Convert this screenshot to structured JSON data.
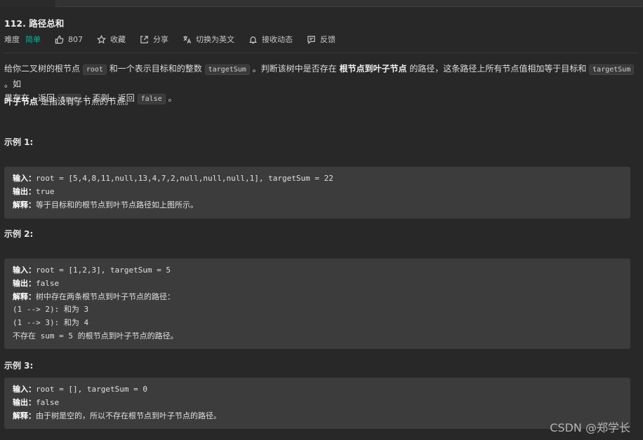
{
  "problem": {
    "title": "112. 路径总和",
    "difficulty_label": "难度",
    "difficulty": "简单",
    "likes": "807",
    "favorite": "收藏",
    "share": "分享",
    "switch_lang": "切换为英文",
    "notify": "接收动态",
    "feedback": "反馈"
  },
  "description": {
    "p1_a": "给你二叉树的根节点",
    "p1_code1": "root",
    "p1_b": "和一个表示目标和的整数",
    "p1_code2": "targetSum",
    "p1_c": "。判断该树中是否存在",
    "p1_bold": "根节点到叶子节点",
    "p1_d": "的路径，这条路径上所有节点值相加等于目标和",
    "p1_code3": "targetSum",
    "p1_e": "。如",
    "p1_f": "果存在，返回",
    "p1_code4": "true",
    "p1_g": "；否则，返回",
    "p1_code5": "false",
    "p1_h": "。",
    "p2_bold": "叶子节点",
    "p2_rest": "是指没有子节点的节点。"
  },
  "examples": [
    {
      "title": "示例 1:",
      "input_label": "输入：",
      "input": "root = [5,4,8,11,null,13,4,7,2,null,null,null,1], targetSum = 22",
      "output_label": "输出：",
      "output": "true",
      "explain_label": "解释：",
      "explain": "等于目标和的根节点到叶节点路径如上图所示。"
    },
    {
      "title": "示例 2:",
      "input_label": "输入：",
      "input": "root = [1,2,3], targetSum = 5",
      "output_label": "输出：",
      "output": "false",
      "explain_label": "解释：",
      "explain": "树中存在两条根节点到叶子节点的路径：",
      "extra1": "(1 --> 2): 和为 3",
      "extra2": "(1 --> 3): 和为 4",
      "extra3": "不存在 sum = 5 的根节点到叶子节点的路径。"
    },
    {
      "title": "示例 3:",
      "input_label": "输入：",
      "input": "root = [], targetSum = 0",
      "output_label": "输出：",
      "output": "false",
      "explain_label": "解释：",
      "explain": "由于树是空的，所以不存在根节点到叶子节点的路径。"
    }
  ],
  "watermark": "CSDN @郑学长",
  "icons": [
    "thumbs-up-icon",
    "star-icon",
    "share-icon",
    "translate-icon",
    "bell-icon",
    "feedback-icon"
  ]
}
